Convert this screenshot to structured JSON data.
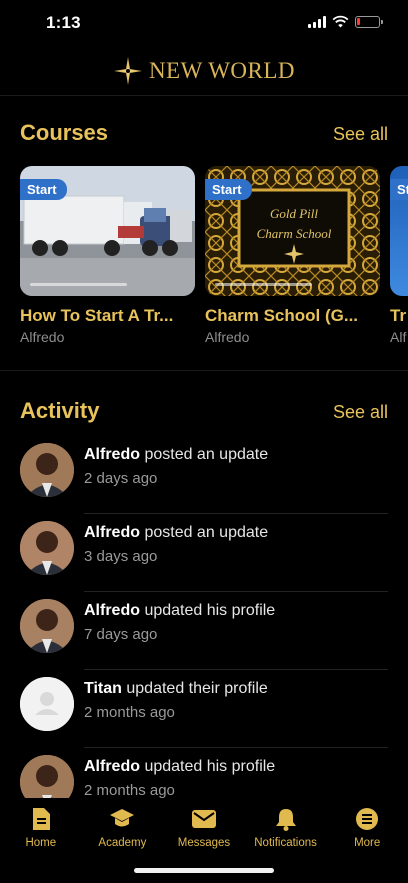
{
  "status_bar": {
    "time": "1:13",
    "battery_level": 0.12
  },
  "header": {
    "logo_text": "NEW WORLD",
    "logo_icon": "compass-star-icon"
  },
  "courses": {
    "title": "Courses",
    "see_all": "See all",
    "items": [
      {
        "badge": "Start",
        "title": "How To Start A Tr...",
        "author": "Alfredo",
        "thumbnail": "semi-truck-photo"
      },
      {
        "badge": "Start",
        "title": "Charm School (G...",
        "author": "Alfredo",
        "thumbnail_text_line1": "Gold Pill",
        "thumbnail_text_line2": "Charm School"
      },
      {
        "badge": "St",
        "title": "Tr",
        "author": "Alf"
      }
    ]
  },
  "activity": {
    "title": "Activity",
    "see_all": "See all",
    "items": [
      {
        "name": "Alfredo",
        "action": " posted an update",
        "time": "2 days ago",
        "avatar": "photo"
      },
      {
        "name": "Alfredo",
        "action": " posted an update",
        "time": "3 days ago",
        "avatar": "photo"
      },
      {
        "name": "Alfredo",
        "action": " updated his profile",
        "time": "7 days ago",
        "avatar": "photo"
      },
      {
        "name": "Titan",
        "action": " updated their profile",
        "time": "2 months ago",
        "avatar": "placeholder"
      },
      {
        "name": "Alfredo",
        "action": " updated his profile",
        "time": "2 months ago",
        "avatar": "photo"
      }
    ]
  },
  "tab_bar": {
    "items": [
      {
        "label": "Home",
        "icon": "document-icon"
      },
      {
        "label": "Academy",
        "icon": "graduation-cap-icon"
      },
      {
        "label": "Messages",
        "icon": "envelope-icon"
      },
      {
        "label": "Notifications",
        "icon": "bell-icon"
      },
      {
        "label": "More",
        "icon": "list-icon"
      }
    ]
  },
  "colors": {
    "accent_gold": "#e8c25b",
    "badge_blue": "#2f71c9",
    "background": "#000000"
  }
}
